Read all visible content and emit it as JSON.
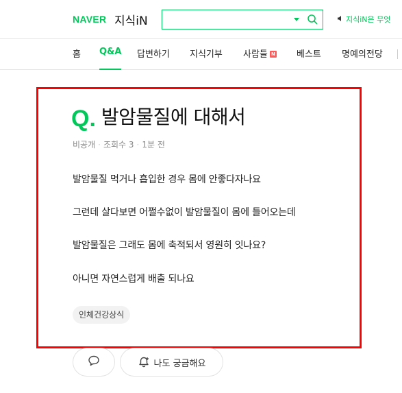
{
  "header": {
    "brand": "NAVER",
    "service": "지식iN",
    "search_value": "",
    "notice": "지식iN은 무엇"
  },
  "nav": {
    "items": [
      {
        "label": "홈"
      },
      {
        "label": "Q&A"
      },
      {
        "label": "답변하기"
      },
      {
        "label": "지식기부"
      },
      {
        "label": "사람들"
      },
      {
        "label": "베스트"
      },
      {
        "label": "명예의전당"
      }
    ],
    "active": "Q&A",
    "new_badge": "N"
  },
  "question": {
    "q_mark": "Q.",
    "title": "발암물질에 대해서",
    "meta": {
      "author": "비공개",
      "views": "조회수 3",
      "time": "1분 전"
    },
    "body": [
      "발암물질 먹거나 흡입한 경우 몸에 안좋다자나요",
      "그런데 살다보면 어쩔수없이 발암물질이 몸에 들어오는데",
      "발암물질은 그래도 몸에 축적되서 영원히 잇나요?",
      "아니면 자연스럽게 배출 되나요"
    ],
    "tag": "인체건강상식"
  },
  "actions": {
    "curious_label": "나도 궁금해요"
  },
  "colors": {
    "brand": "#03c75a",
    "highlight": "#ff0000"
  }
}
